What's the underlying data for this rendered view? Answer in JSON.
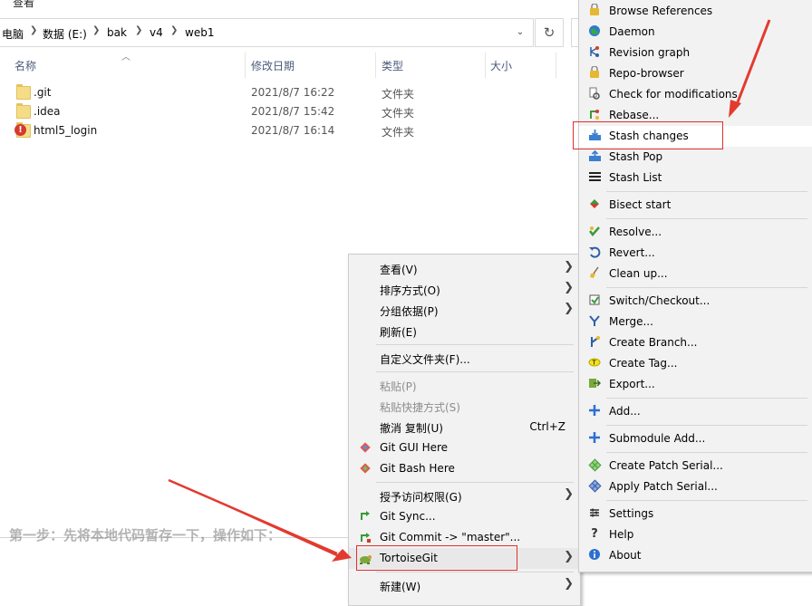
{
  "explorer": {
    "menu_tab": "查看",
    "breadcrumb": [
      "电脑",
      "数据 (E:)",
      "bak",
      "v4",
      "web1"
    ],
    "columns": [
      "名称",
      "修改日期",
      "类型",
      "大小"
    ],
    "files": [
      {
        "name": ".git",
        "date": "2021/8/7 16:22",
        "type": "文件夹",
        "icon": "folder-icon"
      },
      {
        "name": ".idea",
        "date": "2021/8/7 15:42",
        "type": "文件夹",
        "icon": "folder-icon"
      },
      {
        "name": "html5_login",
        "date": "2021/8/7 16:14",
        "type": "文件夹",
        "icon": "conflict-folder-icon"
      }
    ],
    "background_text": "第一步：先将本地代码暂存一下，操作如下："
  },
  "context_menu": {
    "items": [
      {
        "label": "查看(V)",
        "submenu": true
      },
      {
        "label": "排序方式(O)",
        "submenu": true
      },
      {
        "label": "分组依据(P)",
        "submenu": true
      },
      {
        "label": "刷新(E)"
      },
      {
        "label": "自定义文件夹(F)..."
      },
      {
        "label": "粘贴(P)",
        "disabled": true
      },
      {
        "label": "粘贴快捷方式(S)",
        "disabled": true
      },
      {
        "label": "撤消 复制(U)",
        "shortcut": "Ctrl+Z"
      },
      {
        "label": "Git GUI Here",
        "icon": "git-gui-icon"
      },
      {
        "label": "Git Bash Here",
        "icon": "git-bash-icon"
      },
      {
        "label": "授予访问权限(G)",
        "submenu": true
      },
      {
        "label": "Git Sync...",
        "icon": "git-sync-icon"
      },
      {
        "label": "Git Commit -> \"master\"...",
        "icon": "git-commit-icon"
      },
      {
        "label": "TortoiseGit",
        "submenu": true,
        "icon": "tortoisegit-icon",
        "highlighted": true
      },
      {
        "label": "新建(W)",
        "submenu": true
      }
    ]
  },
  "tortoise_menu": {
    "items": [
      {
        "label": "Browse References",
        "icon": "browse-references-icon"
      },
      {
        "label": "Daemon",
        "icon": "daemon-icon"
      },
      {
        "label": "Revision graph",
        "icon": "revision-graph-icon"
      },
      {
        "label": "Repo-browser",
        "icon": "repo-browser-icon"
      },
      {
        "label": "Check for modifications",
        "icon": "check-modifications-icon"
      },
      {
        "label": "Rebase...",
        "icon": "rebase-icon"
      },
      {
        "label": "Stash changes",
        "icon": "stash-changes-icon",
        "highlighted": true
      },
      {
        "label": "Stash Pop",
        "icon": "stash-pop-icon"
      },
      {
        "label": "Stash List",
        "icon": "stash-list-icon"
      },
      {
        "label": "Bisect start",
        "icon": "bisect-icon"
      },
      {
        "label": "Resolve...",
        "icon": "resolve-icon"
      },
      {
        "label": "Revert...",
        "icon": "revert-icon"
      },
      {
        "label": "Clean up...",
        "icon": "cleanup-icon"
      },
      {
        "label": "Switch/Checkout...",
        "icon": "switch-checkout-icon"
      },
      {
        "label": "Merge...",
        "icon": "merge-icon"
      },
      {
        "label": "Create Branch...",
        "icon": "create-branch-icon"
      },
      {
        "label": "Create Tag...",
        "icon": "create-tag-icon"
      },
      {
        "label": "Export...",
        "icon": "export-icon"
      },
      {
        "label": "Add...",
        "icon": "add-icon"
      },
      {
        "label": "Submodule Add...",
        "icon": "submodule-add-icon"
      },
      {
        "label": "Create Patch Serial...",
        "icon": "create-patch-icon"
      },
      {
        "label": "Apply Patch Serial...",
        "icon": "apply-patch-icon"
      },
      {
        "label": "Settings",
        "icon": "settings-icon"
      },
      {
        "label": "Help",
        "icon": "help-icon"
      },
      {
        "label": "About",
        "icon": "about-icon"
      }
    ]
  },
  "colors": {
    "annotation": "#e0302e",
    "menu_bg": "#f2f2f2",
    "disabled_text": "#8d8d8d"
  }
}
